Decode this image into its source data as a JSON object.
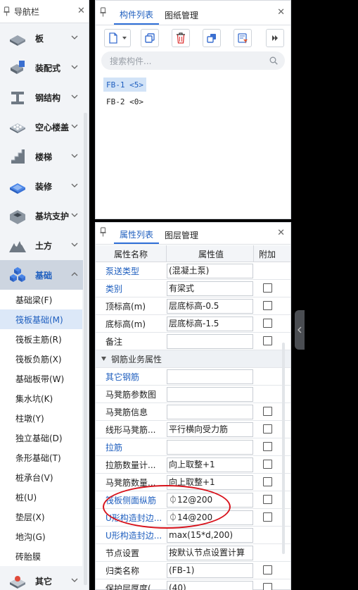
{
  "nav": {
    "title": "导航栏",
    "categories": [
      {
        "label": "板",
        "icon": "slab-icon"
      },
      {
        "label": "装配式",
        "icon": "prefab-icon"
      },
      {
        "label": "钢结构",
        "icon": "steel-structure-icon"
      },
      {
        "label": "空心楼盖",
        "icon": "hollow-floor-icon"
      },
      {
        "label": "楼梯",
        "icon": "stairs-icon"
      },
      {
        "label": "装修",
        "icon": "decoration-icon"
      },
      {
        "label": "基坑支护",
        "icon": "pit-support-icon"
      },
      {
        "label": "土方",
        "icon": "earthwork-icon"
      },
      {
        "label": "基础",
        "icon": "foundation-icon"
      }
    ],
    "sub_items": [
      "基础梁(F)",
      "筏板基础(M)",
      "筏板主筋(R)",
      "筏板负筋(X)",
      "基础板带(W)",
      "集水坑(K)",
      "柱墩(Y)",
      "独立基础(D)",
      "条形基础(T)",
      "桩承台(V)",
      "桩(U)",
      "垫层(X)",
      "地沟(G)",
      "砖胎膜"
    ],
    "bottom_category": {
      "label": "其它",
      "icon": "other-icon"
    }
  },
  "component_panel": {
    "tabs": [
      "构件列表",
      "图纸管理"
    ],
    "search_placeholder": "搜索构件...",
    "items": [
      "FB-1 <5>",
      "FB-2 <0>"
    ]
  },
  "property_panel": {
    "tabs": [
      "属性列表",
      "图层管理"
    ],
    "headers": [
      "属性名称",
      "属性值",
      "附加"
    ],
    "rows_top": [
      {
        "name": "泵送类型",
        "value": "(混凝土泵)",
        "link": true,
        "checkbox": false
      },
      {
        "name": "类别",
        "value": "有梁式",
        "link": true,
        "checkbox": true
      },
      {
        "name": "顶标高(m)",
        "value": "层底标高-0.5",
        "link": false,
        "checkbox": true
      },
      {
        "name": "底标高(m)",
        "value": "层底标高-1.5",
        "link": false,
        "checkbox": true
      },
      {
        "name": "备注",
        "value": "",
        "link": false,
        "checkbox": true
      }
    ],
    "group_label": "钢筋业务属性",
    "rows_rebar": [
      {
        "name": "其它钢筋",
        "value": "",
        "link": true,
        "checkbox": false
      },
      {
        "name": "马凳筋参数图",
        "value": "",
        "link": false,
        "checkbox": false
      },
      {
        "name": "马凳筋信息",
        "value": "",
        "link": false,
        "checkbox": true
      },
      {
        "name": "线形马凳筋...",
        "value": "平行横向受力筋",
        "link": false,
        "checkbox": true
      },
      {
        "name": "拉筋",
        "value": "",
        "link": true,
        "checkbox": true
      },
      {
        "name": "拉筋数量计...",
        "value": "向上取整+1",
        "link": false,
        "checkbox": true
      },
      {
        "name": "马凳筋数量...",
        "value": "向上取整+1",
        "link": false,
        "checkbox": true
      },
      {
        "name": "筏板侧面纵筋",
        "value": "⏀12@200",
        "link": true,
        "checkbox": true
      },
      {
        "name": "U形构造封边...",
        "value": "⏀14@200",
        "link": true,
        "checkbox": true
      },
      {
        "name": "U形构造封边...",
        "value": "max(15*d,200)",
        "link": true,
        "checkbox": false
      },
      {
        "name": "节点设置",
        "value": "按默认节点设置计算",
        "link": false,
        "checkbox": false
      },
      {
        "name": "归类名称",
        "value": "(FB-1)",
        "link": false,
        "checkbox": true
      },
      {
        "name": "保护层厚度(...",
        "value": "(40)",
        "link": false,
        "checkbox": true
      }
    ]
  },
  "colors": {
    "accent": "#1f5fbf",
    "annotation": "#d8121b"
  }
}
